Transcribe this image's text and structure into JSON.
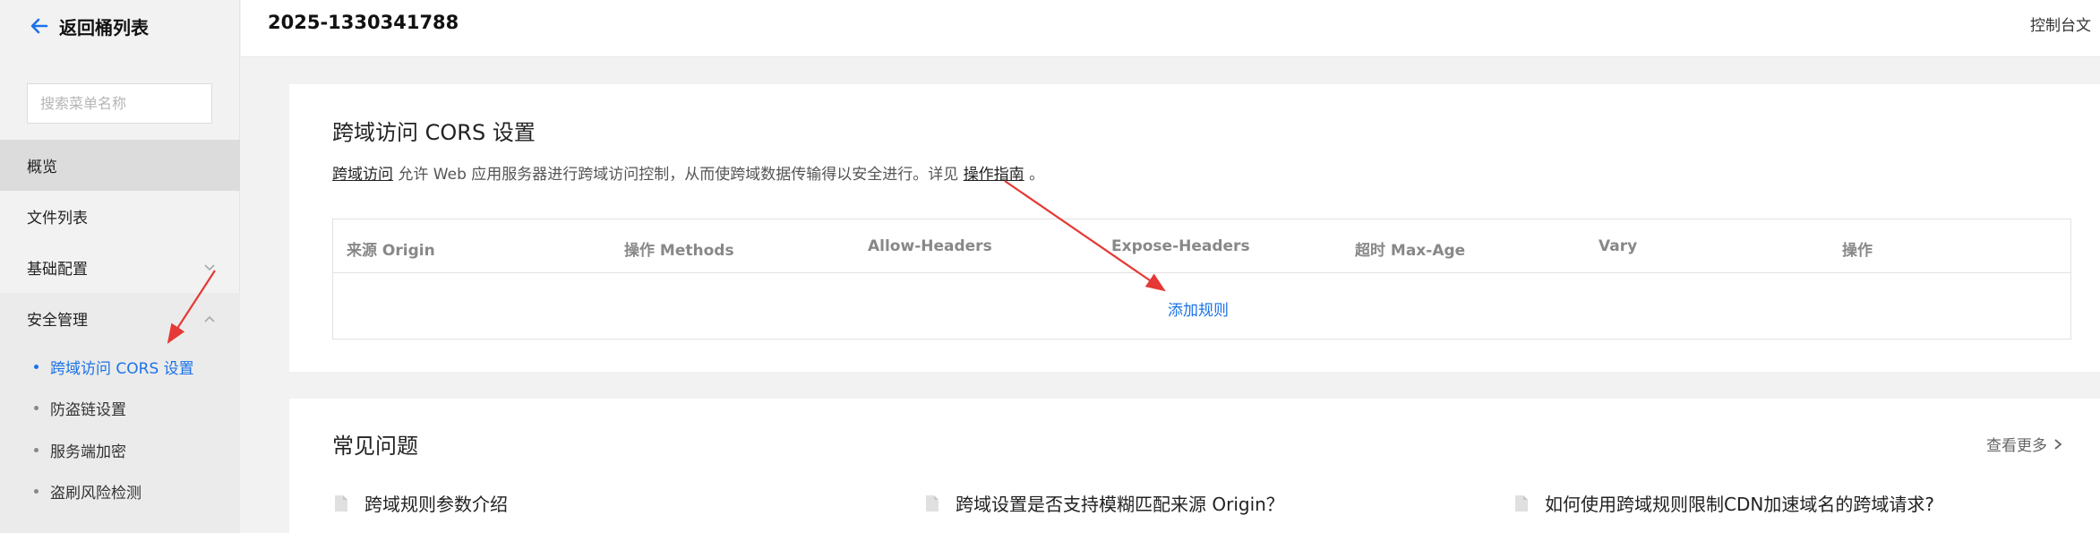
{
  "sidebar": {
    "back_label": "返回桶列表",
    "search_placeholder": "搜索菜单名称",
    "items": [
      {
        "label": "概览"
      },
      {
        "label": "文件列表"
      },
      {
        "label": "基础配置"
      },
      {
        "label": "安全管理"
      }
    ],
    "security_subitems": [
      {
        "label": "跨域访问 CORS 设置"
      },
      {
        "label": "防盗链设置"
      },
      {
        "label": "服务端加密"
      },
      {
        "label": "盗刷风险检测"
      }
    ]
  },
  "header": {
    "bucket_name": "2025-1330341788",
    "console_link": "控制台文"
  },
  "cors": {
    "title": "跨域访问 CORS 设置",
    "desc_link": "跨域访问",
    "desc_text": " 允许 Web 应用服务器进行跨域访问控制，从而使跨域数据传输得以安全进行。详见 ",
    "guide_link": "操作指南",
    "desc_end": " 。",
    "columns": [
      "来源 Origin",
      "操作 Methods",
      "Allow-Headers",
      "Expose-Headers",
      "超时 Max-Age",
      "Vary",
      "操作"
    ],
    "add_rule": "添加规则"
  },
  "faq": {
    "title": "常见问题",
    "view_more": "查看更多",
    "items": [
      "跨域规则参数介绍",
      "跨域设置是否支持模糊匹配来源 Origin？",
      "如何使用跨域规则限制CDN加速域名的跨域请求?"
    ]
  },
  "colors": {
    "accent": "#1a73e8",
    "annotation_arrow": "#e53935"
  }
}
